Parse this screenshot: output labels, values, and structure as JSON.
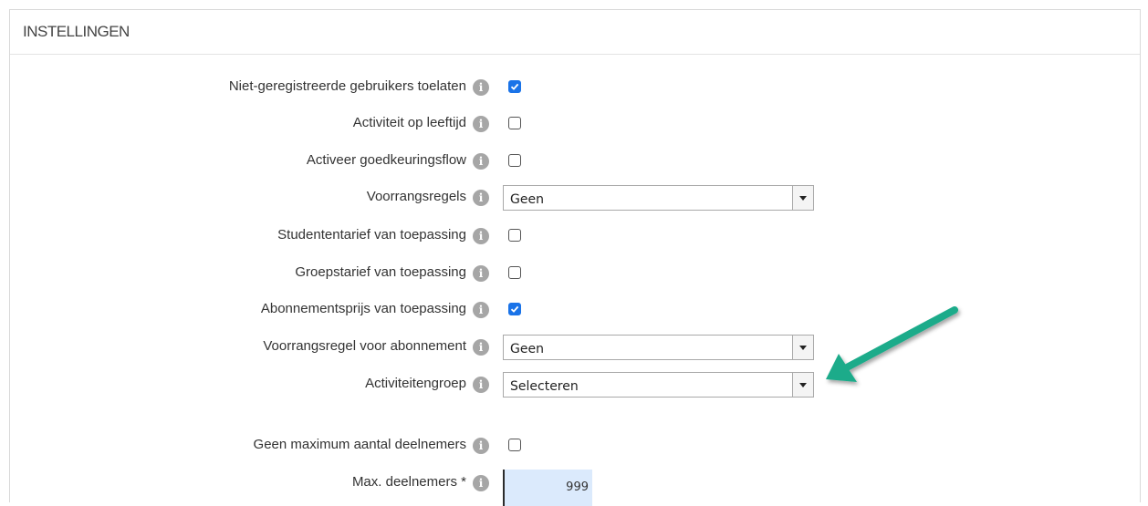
{
  "panel": {
    "title": "INSTELLINGEN"
  },
  "info_glyph": "i",
  "rows": [
    {
      "label": "Niet-geregistreerde gebruikers toelaten",
      "type": "checkbox",
      "checked": true
    },
    {
      "label": "Activiteit op leeftijd",
      "type": "checkbox",
      "checked": false
    },
    {
      "label": "Activeer goedkeuringsflow",
      "type": "checkbox",
      "checked": false
    },
    {
      "label": "Voorrangsregels",
      "type": "select",
      "value": "Geen"
    },
    {
      "label": "Studententarief van toepassing",
      "type": "checkbox",
      "checked": false
    },
    {
      "label": "Groepstarief van toepassing",
      "type": "checkbox",
      "checked": false
    },
    {
      "label": "Abonnementsprijs van toepassing",
      "type": "checkbox",
      "checked": true
    },
    {
      "label": "Voorrangsregel voor abonnement",
      "type": "select",
      "value": "Geen"
    },
    {
      "label": "Activiteitengroep",
      "type": "select",
      "value": "Selecteren"
    },
    {
      "label": "Geen maximum aantal deelnemers",
      "type": "checkbox",
      "checked": false
    },
    {
      "label": "Max. deelnemers *",
      "type": "number",
      "value": "999"
    }
  ],
  "colors": {
    "checkbox_checked": "#1a73e8",
    "annotation_arrow": "#1aab8a"
  }
}
